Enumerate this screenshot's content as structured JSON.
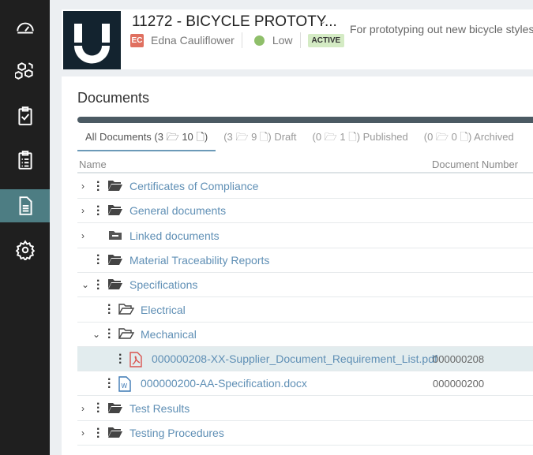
{
  "sidebar": {
    "items": [
      {
        "name": "dashboard"
      },
      {
        "name": "parts"
      },
      {
        "name": "tasks"
      },
      {
        "name": "checklist"
      },
      {
        "name": "documents",
        "active": true
      },
      {
        "name": "settings"
      }
    ]
  },
  "header": {
    "title": "11272 - BICYCLE PROTOTY...",
    "owner_initials": "EC",
    "owner": "Edna Cauliflower",
    "priority": "Low",
    "status": "ACTIVE",
    "description": "For prototyping out new bicycle styles"
  },
  "documents": {
    "title": "Documents",
    "tabs": [
      {
        "label": "All Documents (3 🗁 10 🗋)"
      },
      {
        "label": "(3 🗁 9 🗋) Draft"
      },
      {
        "label": "(0 🗁 1 🗋) Published"
      },
      {
        "label": "(0 🗁 0 🗋) Archived"
      }
    ],
    "columns": {
      "name": "Name",
      "number": "Document Number"
    },
    "rows": [
      {
        "name": "Certificates of Compliance",
        "type": "folder",
        "level": 0,
        "expander": "›",
        "number": ""
      },
      {
        "name": "General documents",
        "type": "folder",
        "level": 0,
        "expander": "›",
        "number": ""
      },
      {
        "name": "Linked documents",
        "type": "linked",
        "level": 0,
        "expander": "›",
        "number": ""
      },
      {
        "name": "Material Traceability Reports",
        "type": "folder",
        "level": 0,
        "expander": "",
        "number": ""
      },
      {
        "name": "Specifications",
        "type": "folder",
        "level": 0,
        "expander": "⌄",
        "number": ""
      },
      {
        "name": "Electrical",
        "type": "folder-open",
        "level": 1,
        "expander": "",
        "number": ""
      },
      {
        "name": "Mechanical",
        "type": "folder-open",
        "level": 1,
        "expander": "⌄",
        "number": ""
      },
      {
        "name": "000000208-XX-Supplier_Document_Requirement_List.pdf",
        "type": "pdf",
        "level": 2,
        "expander": "",
        "number": "000000208",
        "selected": true
      },
      {
        "name": "000000200-AA-Specification.docx",
        "type": "word",
        "level": 1,
        "expander": "",
        "number": "000000200"
      },
      {
        "name": "Test Results",
        "type": "folder",
        "level": 0,
        "expander": "›",
        "number": ""
      },
      {
        "name": "Testing Procedures",
        "type": "folder",
        "level": 0,
        "expander": "›",
        "number": ""
      }
    ]
  }
}
